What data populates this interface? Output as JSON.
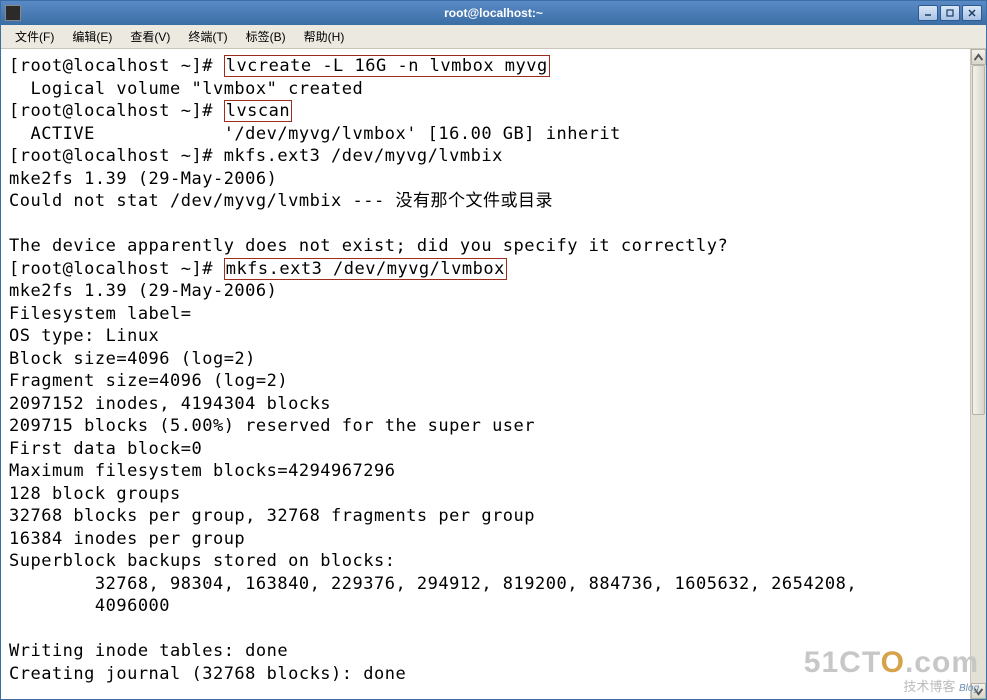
{
  "window": {
    "title": "root@localhost:~"
  },
  "menu": {
    "file": "文件(F)",
    "edit": "编辑(E)",
    "view": "查看(V)",
    "terminal": "终端(T)",
    "tabs": "标签(B)",
    "help": "帮助(H)"
  },
  "prompt": "[root@localhost ~]# ",
  "cmd": {
    "lvcreate": "lvcreate -L 16G -n lvmbox myvg",
    "lvscan": "lvscan",
    "mkfs_bad": "mkfs.ext3 /dev/myvg/lvmbix",
    "mkfs_good": "mkfs.ext3 /dev/myvg/lvmbox"
  },
  "out": {
    "lvcreated": "  Logical volume \"lvmbox\" created",
    "active": "  ACTIVE            '/dev/myvg/lvmbox' [16.00 GB] inherit",
    "mke2fs": "mke2fs 1.39 (29-May-2006)",
    "nostat": "Could not stat /dev/myvg/lvmbix --- 没有那个文件或目录",
    "noexist": "The device apparently does not exist; did you specify it correctly?",
    "fslabel": "Filesystem label=",
    "ostype": "OS type: Linux",
    "blksize": "Block size=4096 (log=2)",
    "fragsize": "Fragment size=4096 (log=2)",
    "inodes": "2097152 inodes, 4194304 blocks",
    "reserved": "209715 blocks (5.00%) reserved for the super user",
    "firstdb": "First data block=0",
    "maxfs": "Maximum filesystem blocks=4294967296",
    "bgroups": "128 block groups",
    "pergroup": "32768 blocks per group, 32768 fragments per group",
    "inodesper": "16384 inodes per group",
    "sbheader": "Superblock backups stored on blocks:",
    "sb1": "        32768, 98304, 163840, 229376, 294912, 819200, 884736, 1605632, 2654208,",
    "sb2": "        4096000",
    "writing": "Writing inode tables: done",
    "journal": "Creating journal (32768 blocks): done"
  },
  "watermark": {
    "main_pre": "51CT",
    "main_o": "O",
    "main_post": ".com",
    "sub": "技术博客",
    "blog": "Blog"
  }
}
